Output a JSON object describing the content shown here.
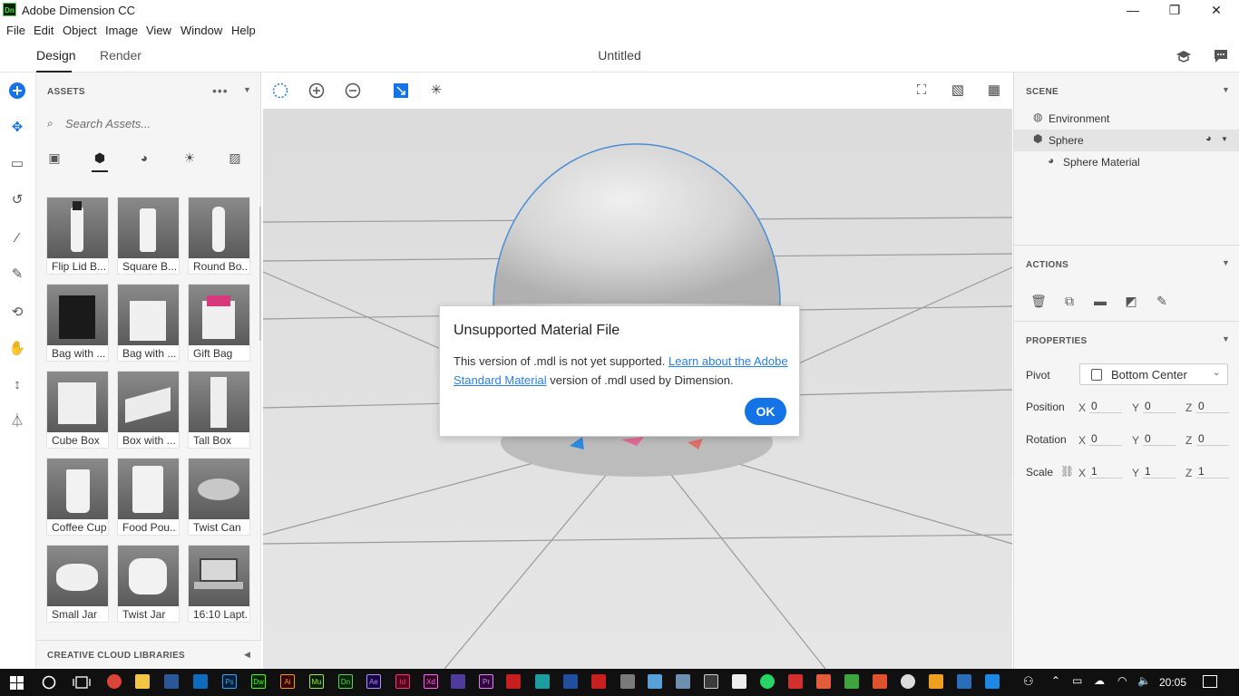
{
  "window": {
    "title": "Adobe Dimension CC",
    "icon_label": "Dn",
    "minimize": "—",
    "maximize": "❐",
    "close": "✕"
  },
  "menu": [
    "File",
    "Edit",
    "Object",
    "Image",
    "View",
    "Window",
    "Help"
  ],
  "header": {
    "tabs": [
      "Design",
      "Render"
    ],
    "active_tab": "Design",
    "document_title": "Untitled"
  },
  "assets": {
    "title": "ASSETS",
    "search_placeholder": "Search Assets...",
    "tiles": [
      "Flip Lid B...",
      "Square B...",
      "Round Bo...",
      "Bag with ...",
      "Bag with ...",
      "Gift Bag",
      "Cube Box",
      "Box with ...",
      "Tall Box",
      "Coffee Cup",
      "Food Pou...",
      "Twist Can",
      "Small Jar",
      "Twist Jar",
      "16:10 Lapt..."
    ],
    "libraries": "CREATIVE CLOUD LIBRARIES"
  },
  "dialog": {
    "title": "Unsupported Material File",
    "body_pre": "This version of .mdl is not yet supported. ",
    "link": "Learn about the Adobe Standard Material",
    "body_post": " version of .mdl used by Dimension.",
    "ok": "OK"
  },
  "scene": {
    "title": "SCENE",
    "items": [
      "Environment",
      "Sphere",
      "Sphere Material"
    ],
    "selected": "Sphere"
  },
  "actions": {
    "title": "ACTIONS"
  },
  "properties": {
    "title": "PROPERTIES",
    "pivot_label": "Pivot",
    "pivot_value": "Bottom Center",
    "position_label": "Position",
    "rotation_label": "Rotation",
    "scale_label": "Scale",
    "axes": [
      "X",
      "Y",
      "Z"
    ],
    "position": [
      "0",
      "0",
      "0"
    ],
    "rotation": [
      "0",
      "0",
      "0"
    ],
    "scale": [
      "1",
      "1",
      "1"
    ]
  },
  "taskbar": {
    "time": "20:05"
  },
  "colors": {
    "accent": "#1473e6",
    "link": "#2680eb",
    "selection": "#4a8fd6"
  }
}
